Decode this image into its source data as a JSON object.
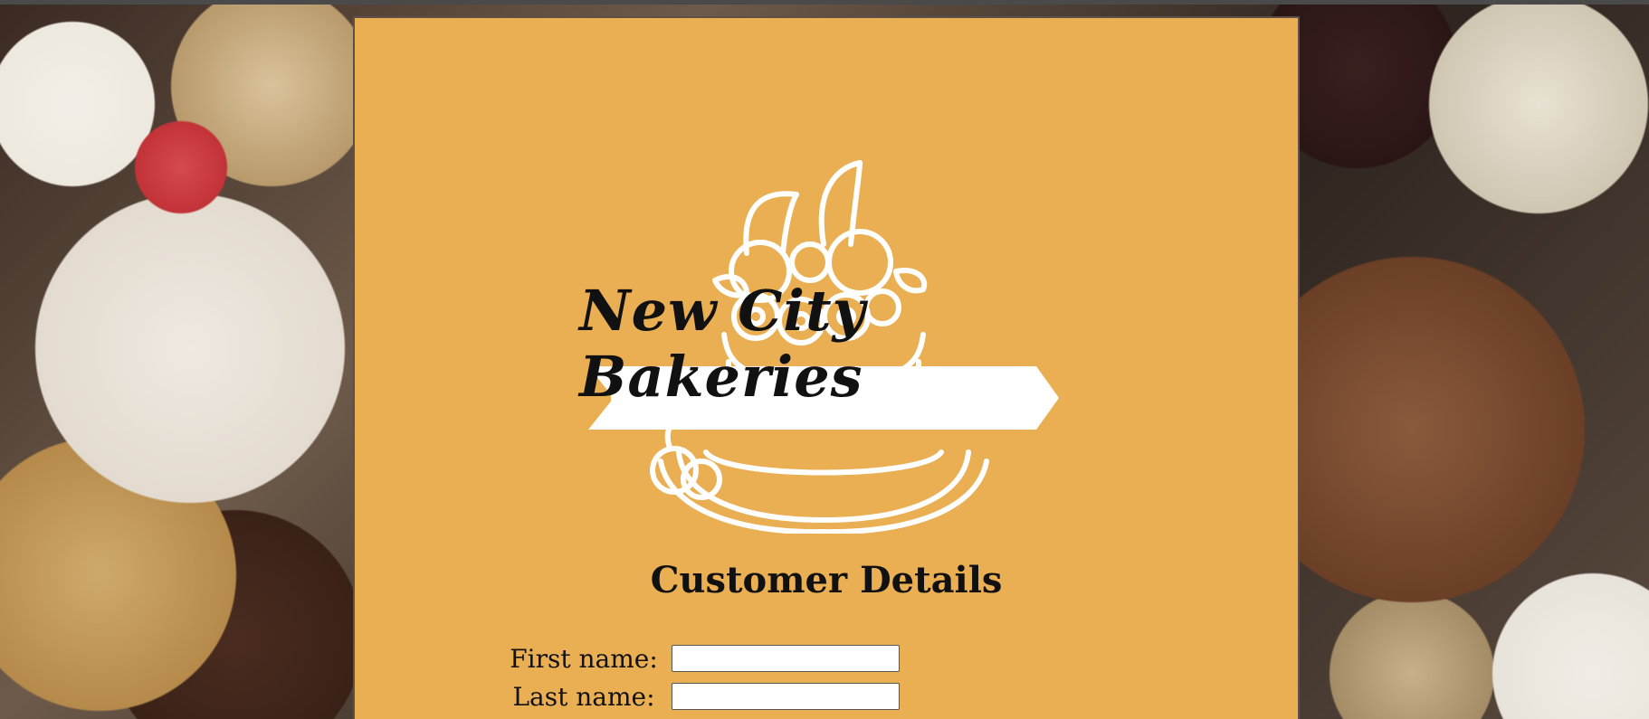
{
  "brand": {
    "name": "New City Bakeries",
    "logo_icon": "cake-with-cherries-icon"
  },
  "page": {
    "heading": "Customer Details"
  },
  "form": {
    "first_name": {
      "label": "First name:",
      "value": ""
    },
    "last_name": {
      "label": "Last name:",
      "value": ""
    }
  },
  "colors": {
    "panel_background": "#ebaf53",
    "logo_white": "#ffffff",
    "text": "#111111"
  }
}
